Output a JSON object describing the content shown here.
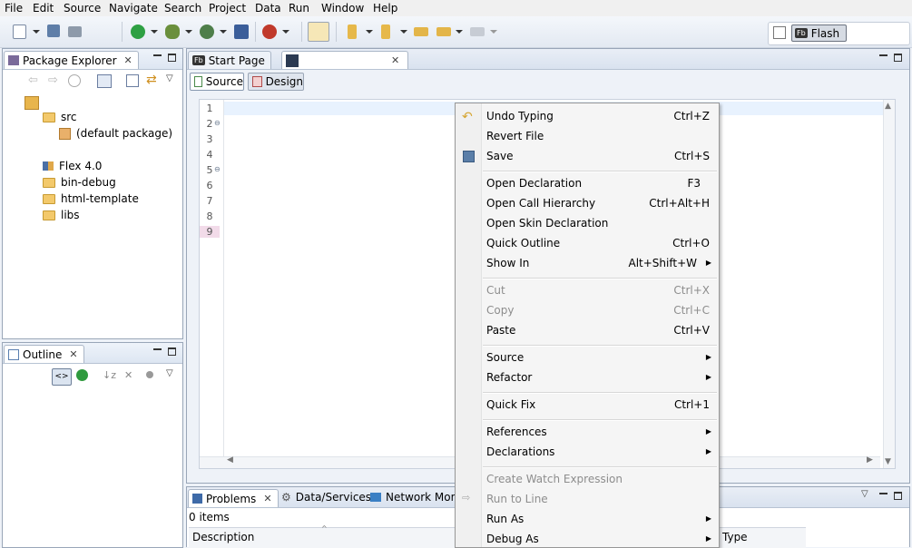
{
  "menubar": {
    "items": [
      "File",
      "Edit",
      "Source",
      "Navigate",
      "Search",
      "Project",
      "Data",
      "Run",
      "Window",
      "Help"
    ]
  },
  "perspective": {
    "label": "Flash",
    "badge": "Fb"
  },
  "package_explorer": {
    "title": "Package Explorer",
    "tree": [
      {
        "label": "src",
        "icon": "source-folder-icon"
      },
      {
        "label": "(default package)",
        "icon": "package-icon"
      },
      {
        "label": "Flex 4.0",
        "icon": "library-icon"
      },
      {
        "label": "bin-debug",
        "icon": "folder-icon"
      },
      {
        "label": "html-template",
        "icon": "folder-icon"
      },
      {
        "label": "libs",
        "icon": "folder-icon"
      }
    ]
  },
  "outline": {
    "title": "Outline"
  },
  "editor": {
    "tabs": [
      {
        "label": "Start Page",
        "badge": "Fb"
      },
      {
        "label": ""
      }
    ],
    "mode_tabs": [
      "Source",
      "Design"
    ],
    "line_numbers": [
      "1",
      "2",
      "3",
      "4",
      "5",
      "6",
      "7",
      "8",
      "9"
    ]
  },
  "bottom_panel": {
    "tabs": [
      "Problems",
      "Data/Services",
      "Network Mon"
    ],
    "items_count": "0 items",
    "columns": [
      "Description",
      "Type"
    ]
  },
  "context_menu": {
    "items": [
      {
        "label": "Undo Typing",
        "accel": "Ctrl+Z",
        "icon": "undo-icon"
      },
      {
        "label": "Revert File",
        "accel": ""
      },
      {
        "label": "Save",
        "accel": "Ctrl+S",
        "icon": "save-icon"
      },
      {
        "sep": true
      },
      {
        "label": "Open Declaration",
        "accel": "F3"
      },
      {
        "label": "Open Call Hierarchy",
        "accel": "Ctrl+Alt+H"
      },
      {
        "label": "Open Skin Declaration",
        "accel": ""
      },
      {
        "label": "Quick Outline",
        "accel": "Ctrl+O"
      },
      {
        "label": "Show In",
        "accel": "Alt+Shift+W",
        "submenu": true
      },
      {
        "sep": true
      },
      {
        "label": "Cut",
        "accel": "Ctrl+X",
        "disabled": true
      },
      {
        "label": "Copy",
        "accel": "Ctrl+C",
        "disabled": true
      },
      {
        "label": "Paste",
        "accel": "Ctrl+V"
      },
      {
        "sep": true
      },
      {
        "label": "Source",
        "submenu": true
      },
      {
        "label": "Refactor",
        "submenu": true
      },
      {
        "sep": true
      },
      {
        "label": "Quick Fix",
        "accel": "Ctrl+1"
      },
      {
        "sep": true
      },
      {
        "label": "References",
        "submenu": true
      },
      {
        "label": "Declarations",
        "submenu": true
      },
      {
        "sep": true
      },
      {
        "label": "Create Watch Expression",
        "disabled": true
      },
      {
        "label": "Run to Line",
        "disabled": true,
        "icon": "run-to-line-icon"
      },
      {
        "label": "Run As",
        "submenu": true
      },
      {
        "label": "Debug As",
        "submenu": true
      }
    ]
  }
}
